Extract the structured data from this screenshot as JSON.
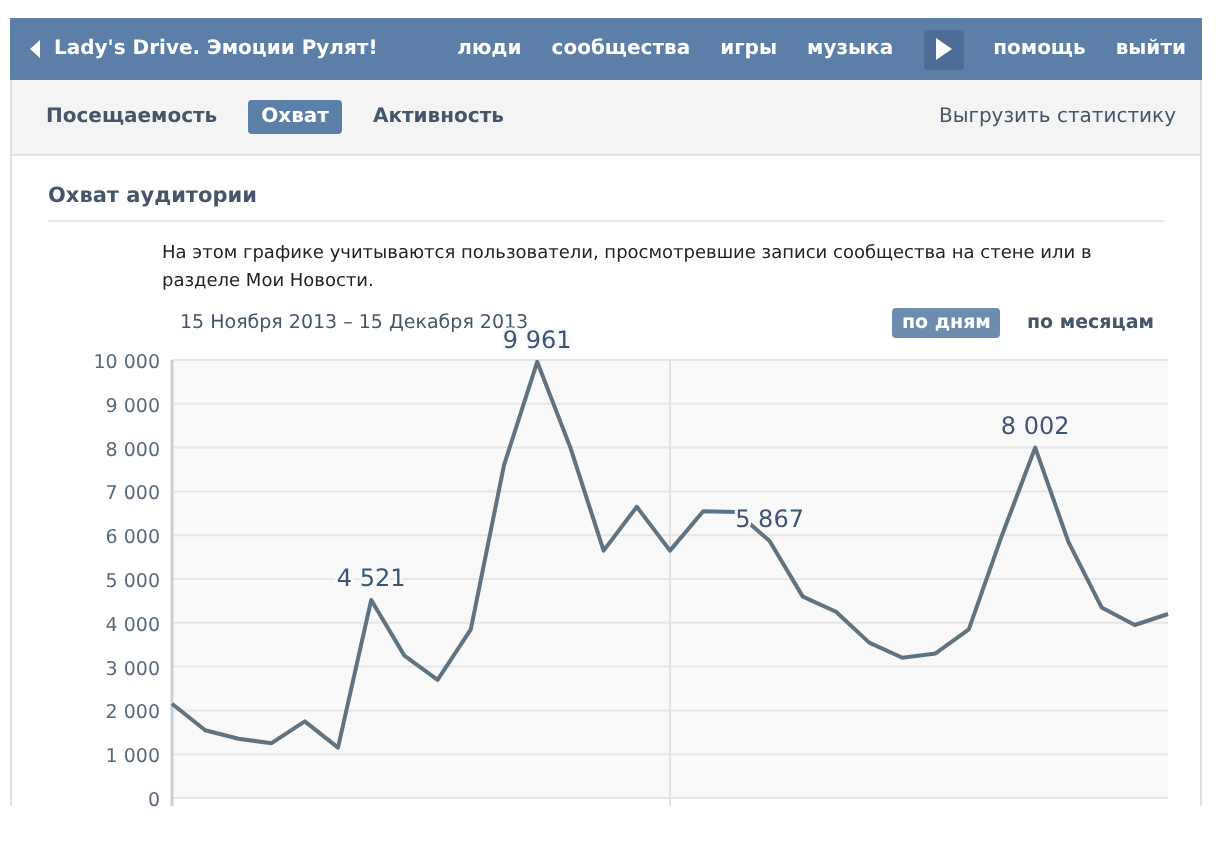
{
  "header": {
    "title": "Lady's Drive. Эмоции Рулят!",
    "nav": [
      {
        "label": "люди",
        "kind": "link"
      },
      {
        "label": "сообщества",
        "kind": "link"
      },
      {
        "label": "игры",
        "kind": "link"
      },
      {
        "label": "музыка",
        "kind": "link"
      },
      {
        "kind": "more"
      },
      {
        "label": "помощь",
        "kind": "link"
      },
      {
        "label": "выйти",
        "kind": "link"
      }
    ]
  },
  "tabs": [
    {
      "label": "Посещаемость",
      "selected": false
    },
    {
      "label": "Охват",
      "selected": true
    },
    {
      "label": "Активность",
      "selected": false
    }
  ],
  "export_link": "Выгрузить статистику",
  "section": {
    "title": "Охват аудитории",
    "description": "На этом графике учитываются пользователи, просмотревшие записи сообщества на стене или в разделе Мои Новости.",
    "date_range": "15 Ноября 2013 – 15 Декабря 2013",
    "period_toggle": [
      {
        "label": "по дням",
        "selected": true
      },
      {
        "label": "по месяцам",
        "selected": false
      }
    ],
    "chart_data": {
      "type": "line",
      "categories": [
        null,
        null,
        null,
        null,
        null,
        null,
        null,
        null,
        null,
        null,
        null,
        null,
        null,
        null,
        null,
        null,
        null,
        null,
        null,
        null,
        null,
        null,
        null,
        null,
        null,
        null,
        null,
        null,
        null,
        null,
        null
      ],
      "series": [
        {
          "color": "#5f7381",
          "values": [
            2150,
            1550,
            1350,
            1250,
            1750,
            1150,
            4521,
            3250,
            2700,
            3850,
            7600,
            9961,
            8000,
            5650,
            6650,
            5650,
            6550,
            6530,
            5867,
            4600,
            4250,
            3550,
            3200,
            3300,
            3850,
            6000,
            8002,
            5850,
            4350,
            3950,
            4200
          ]
        }
      ],
      "ylim": [
        0,
        10000
      ],
      "yticks": [
        {
          "value": 0,
          "label": "0"
        },
        {
          "value": 1000,
          "label": "1 000"
        },
        {
          "value": 2000,
          "label": "2 000"
        },
        {
          "value": 3000,
          "label": "3 000"
        },
        {
          "value": 4000,
          "label": "4 000"
        },
        {
          "value": 5000,
          "label": "5 000"
        },
        {
          "value": 6000,
          "label": "6 000"
        },
        {
          "value": 7000,
          "label": "7 000"
        },
        {
          "value": 8000,
          "label": "8 000"
        },
        {
          "value": 9000,
          "label": "9 000"
        },
        {
          "value": 10000,
          "label": "10 000"
        }
      ],
      "grid": true,
      "annotations": [
        {
          "y": 4521,
          "text": "4 521"
        },
        {
          "y": 9961,
          "text": "9 961"
        },
        {
          "y": 5867,
          "text": "5 867"
        },
        {
          "y": 8002,
          "text": "8 002"
        }
      ]
    }
  }
}
